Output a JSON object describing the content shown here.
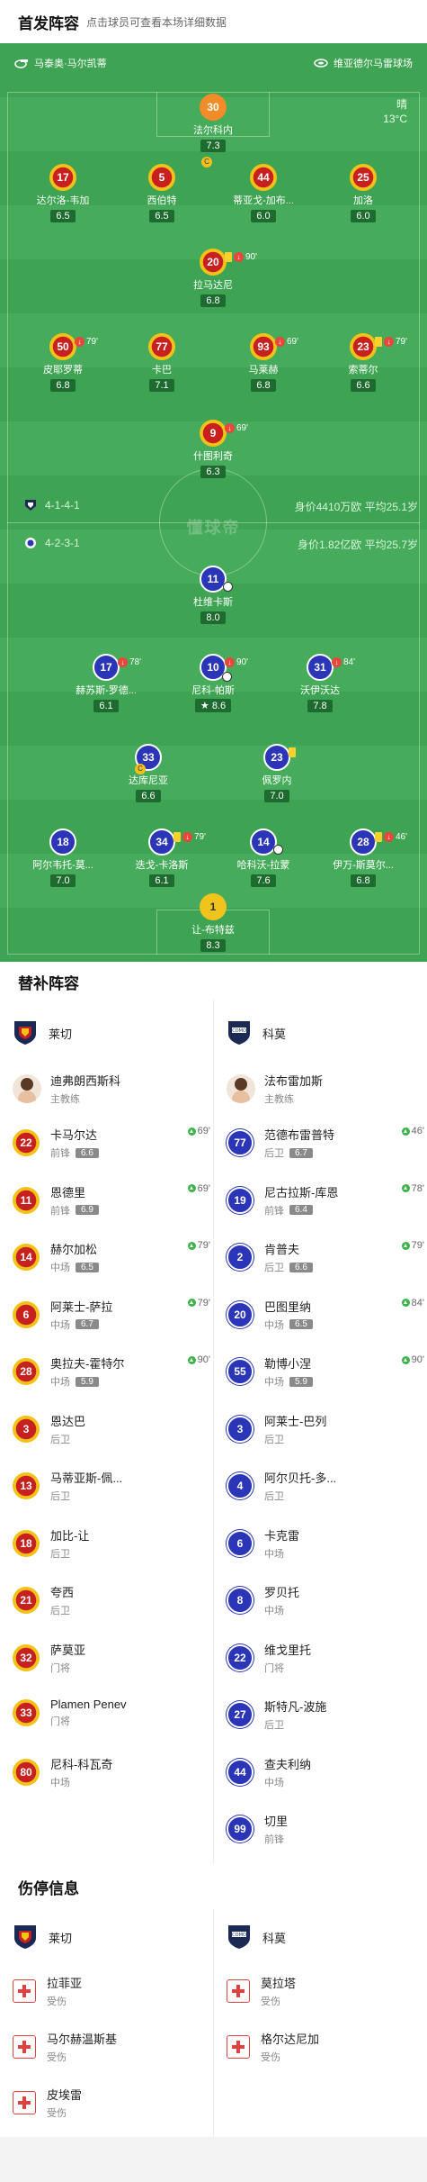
{
  "header": {
    "title": "首发阵容",
    "subtitle": "点击球员可查看本场详细数据"
  },
  "pitch": {
    "home_team": "马泰奥·马尔凯蒂",
    "away_team": "维亚德尔马雷球场",
    "weather": "晴",
    "temperature": "13°C",
    "watermark": "懂球帝",
    "home_formation": "4-1-4-1",
    "away_formation": "4-2-3-1",
    "home_value": "身价4410万欧 平均25.1岁",
    "away_value": "身价1.82亿欧 平均25.7岁"
  },
  "home_players": [
    {
      "num": "30",
      "name": "法尔科内",
      "rating": "7.3",
      "gk": true
    },
    {
      "num": "17",
      "name": "达尔洛-韦加",
      "rating": "6.5"
    },
    {
      "num": "5",
      "name": "西伯特",
      "rating": "6.5"
    },
    {
      "num": "44",
      "name": "蒂亚戈-加布...",
      "rating": "6.0"
    },
    {
      "num": "25",
      "name": "加洛",
      "rating": "6.0"
    },
    {
      "num": "20",
      "name": "拉马达尼",
      "rating": "6.8",
      "minute": "90'"
    },
    {
      "num": "50",
      "name": "皮耶罗蒂",
      "rating": "6.8",
      "minute": "79'"
    },
    {
      "num": "77",
      "name": "卡巴",
      "rating": "7.1"
    },
    {
      "num": "93",
      "name": "马莱赫",
      "rating": "6.8",
      "minute": "69'"
    },
    {
      "num": "23",
      "name": "索蒂尔",
      "rating": "6.6",
      "minute": "79'"
    },
    {
      "num": "9",
      "name": "什图利奇",
      "rating": "6.3",
      "minute": "69'"
    }
  ],
  "away_players": [
    {
      "num": "11",
      "name": "杜维卡斯",
      "rating": "8.0"
    },
    {
      "num": "17",
      "name": "赫苏斯-罗德...",
      "rating": "6.1",
      "minute": "78'"
    },
    {
      "num": "10",
      "name": "尼科-帕斯",
      "rating": "8.6",
      "minute": "90'"
    },
    {
      "num": "31",
      "name": "沃伊沃达",
      "rating": "7.8",
      "minute": "84'"
    },
    {
      "num": "33",
      "name": "达库尼亚",
      "rating": "6.6"
    },
    {
      "num": "23",
      "name": "佩罗内",
      "rating": "7.0"
    },
    {
      "num": "18",
      "name": "阿尔韦托-莫...",
      "rating": "7.0"
    },
    {
      "num": "34",
      "name": "迭戈-卡洛斯",
      "rating": "6.1",
      "minute": "79'"
    },
    {
      "num": "14",
      "name": "哈科沃-拉蒙",
      "rating": "7.6"
    },
    {
      "num": "28",
      "name": "伊万-斯莫尔...",
      "rating": "6.8",
      "minute": "46'"
    },
    {
      "num": "1",
      "name": "让-布特兹",
      "rating": "8.3",
      "gk": true
    }
  ],
  "subs": {
    "title": "替补阵容",
    "home_club": "莱切",
    "away_club": "科莫",
    "home_coach": {
      "name": "迪弗朗西斯科",
      "role": "主教练"
    },
    "away_coach": {
      "name": "法布雷加斯",
      "role": "主教练"
    },
    "home": [
      {
        "num": "22",
        "name": "卡马尔达",
        "pos": "前锋",
        "rating": "6.6",
        "minute": "69'"
      },
      {
        "num": "11",
        "name": "恩德里",
        "pos": "前锋",
        "rating": "6.9",
        "minute": "69'"
      },
      {
        "num": "14",
        "name": "赫尔加松",
        "pos": "中场",
        "rating": "6.5",
        "minute": "79'"
      },
      {
        "num": "6",
        "name": "阿莱士-萨拉",
        "pos": "中场",
        "rating": "6.7",
        "minute": "79'"
      },
      {
        "num": "28",
        "name": "奥拉夫-霍特尔",
        "pos": "中场",
        "rating": "5.9",
        "minute": "90'"
      },
      {
        "num": "3",
        "name": "恩达巴",
        "pos": "后卫"
      },
      {
        "num": "13",
        "name": "马蒂亚斯-佩...",
        "pos": "后卫"
      },
      {
        "num": "18",
        "name": "加比-让",
        "pos": "后卫"
      },
      {
        "num": "21",
        "name": "夸西",
        "pos": "后卫"
      },
      {
        "num": "32",
        "name": "萨莫亚",
        "pos": "门将",
        "gk": true
      },
      {
        "num": "33",
        "name": "Plamen Penev",
        "pos": "门将",
        "gk": true
      },
      {
        "num": "80",
        "name": "尼科-科瓦奇",
        "pos": "中场"
      }
    ],
    "away": [
      {
        "num": "77",
        "name": "范德布雷普特",
        "pos": "后卫",
        "rating": "6.7",
        "minute": "46'"
      },
      {
        "num": "19",
        "name": "尼古拉斯-库恩",
        "pos": "前锋",
        "rating": "6.4",
        "minute": "78'"
      },
      {
        "num": "2",
        "name": "肯普夫",
        "pos": "后卫",
        "rating": "6.6",
        "minute": "79'"
      },
      {
        "num": "20",
        "name": "巴图里纳",
        "pos": "中场",
        "rating": "6.5",
        "minute": "84'"
      },
      {
        "num": "55",
        "name": "勒博小涅",
        "pos": "中场",
        "rating": "5.9",
        "minute": "90'"
      },
      {
        "num": "3",
        "name": "阿莱士-巴列",
        "pos": "后卫"
      },
      {
        "num": "4",
        "name": "阿尔贝托-多...",
        "pos": "后卫"
      },
      {
        "num": "6",
        "name": "卡克雷",
        "pos": "中场"
      },
      {
        "num": "8",
        "name": "罗贝托",
        "pos": "中场"
      },
      {
        "num": "22",
        "name": "维戈里托",
        "pos": "门将"
      },
      {
        "num": "27",
        "name": "斯特凡-波施",
        "pos": "后卫"
      },
      {
        "num": "44",
        "name": "查夫利纳",
        "pos": "中场"
      },
      {
        "num": "99",
        "name": "切里",
        "pos": "前锋"
      }
    ]
  },
  "injuries": {
    "title": "伤停信息",
    "home_club": "莱切",
    "away_club": "科莫",
    "home": [
      {
        "name": "拉菲亚",
        "status": "受伤"
      },
      {
        "name": "马尔赫温斯基",
        "status": "受伤"
      },
      {
        "name": "皮埃雷",
        "status": "受伤"
      }
    ],
    "away": [
      {
        "name": "莫拉塔",
        "status": "受伤"
      },
      {
        "name": "格尔达尼加",
        "status": "受伤"
      }
    ]
  }
}
